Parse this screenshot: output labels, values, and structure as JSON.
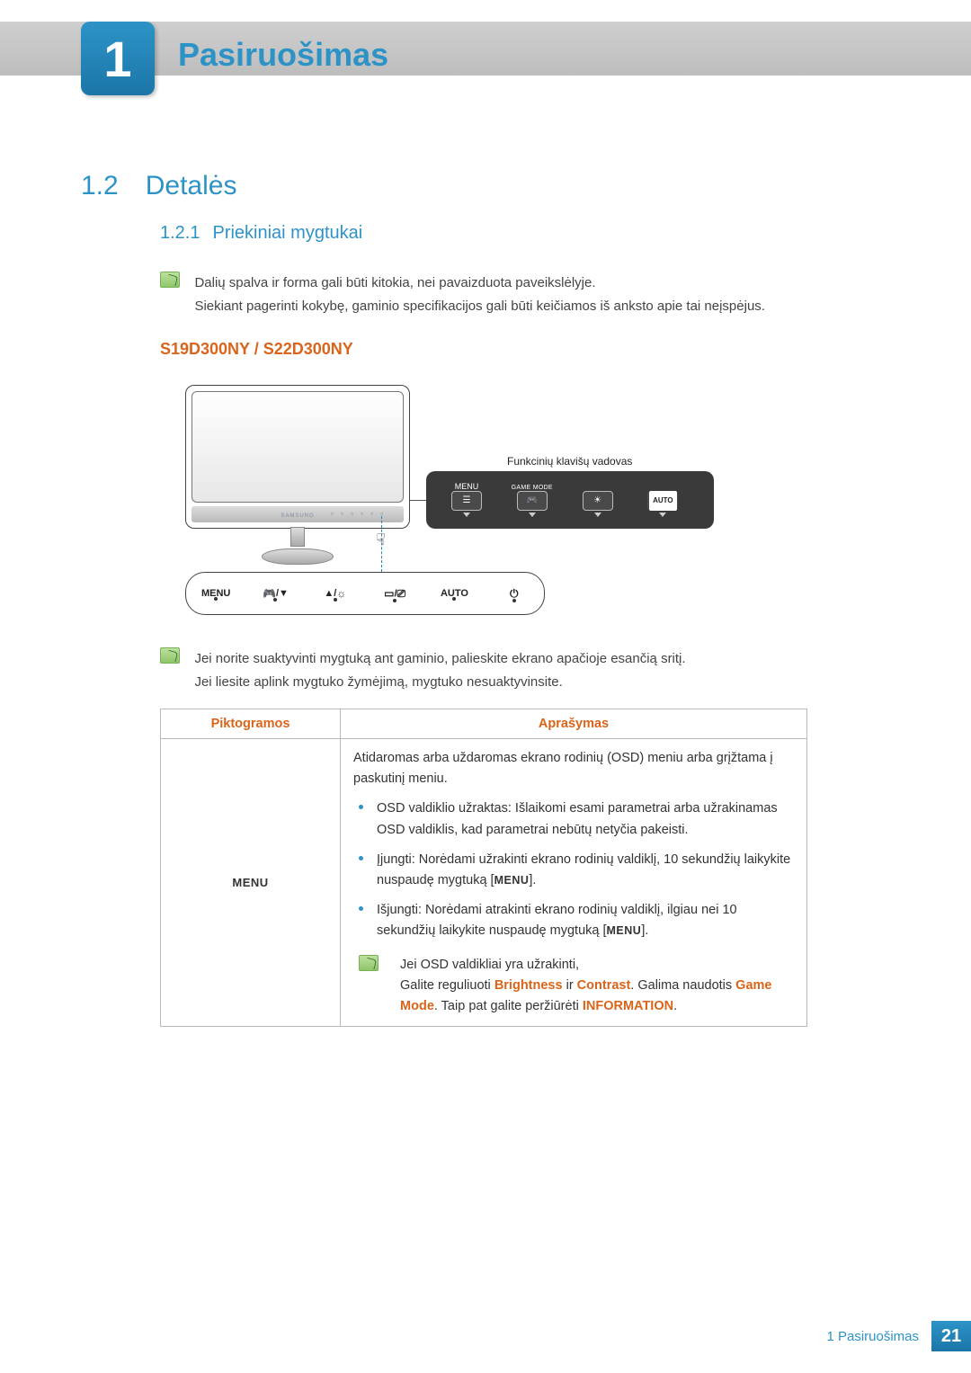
{
  "chapter": {
    "number": "1",
    "title": "Pasiruošimas"
  },
  "section": {
    "number": "1.2",
    "title": "Detalės"
  },
  "subsection": {
    "number": "1.2.1",
    "title": "Priekiniai mygtukai"
  },
  "note1": {
    "line1": "Dalių spalva ir forma gali būti kitokia, nei pavaizduota paveikslėlyje.",
    "line2": "Siekiant pagerinti kokybę, gaminio specifikacijos gali būti keičiamos iš anksto apie tai neįspėjus."
  },
  "model_heading": "S19D300NY / S22D300NY",
  "illustration": {
    "brand": "SAMSUNG",
    "guide_label": "Funkcinių klavišų vadovas",
    "popup": {
      "menu": "MENU",
      "game_mode": "GAME\nMODE",
      "auto": "AUTO"
    },
    "strip": {
      "menu": "MENU",
      "auto": "AUTO"
    }
  },
  "note2": {
    "line1": "Jei norite suaktyvinti mygtuką ant gaminio, palieskite ekrano apačioje esančią sritį.",
    "line2": "Jei liesite aplink mygtuko žymėjimą, mygtuko nesuaktyvinsite."
  },
  "table": {
    "headers": {
      "icons": "Piktogramos",
      "desc": "Aprašymas"
    },
    "row1": {
      "icon_label": "MENU",
      "p_open": "Atidaromas arba uždaromas ekrano rodinių (OSD) meniu arba grįžtama į paskutinį meniu.",
      "li1": "OSD valdiklio užraktas: Išlaikomi esami parametrai arba užrakinamas OSD valdiklis, kad parametrai nebūtų netyčia pakeisti.",
      "li2_a": "Įjungti: Norėdami užrakinti ekrano rodinių valdiklį, 10 sekundžių laikykite nuspaudę mygtuką [",
      "li2_b": "].",
      "li3_a": "Išjungti: Norėdami atrakinti ekrano rodinių valdiklį, ilgiau nei 10 sekundžių laikykite nuspaudę mygtuką [",
      "li3_b": "].",
      "note_head": "Jei OSD valdikliai yra užrakinti,",
      "note_body_a": "Galite reguliuoti ",
      "brightness": "Brightness",
      "note_body_b": " ir ",
      "contrast": "Contrast",
      "note_body_c": ". Galima naudotis ",
      "gamemode": "Game Mode",
      "note_body_d": ". Taip pat galite peržiūrėti ",
      "information": "INFORMATION",
      "note_body_e": "."
    }
  },
  "footer": {
    "chapter_num": "1",
    "chapter_title": "Pasiruošimas",
    "page": "21"
  }
}
